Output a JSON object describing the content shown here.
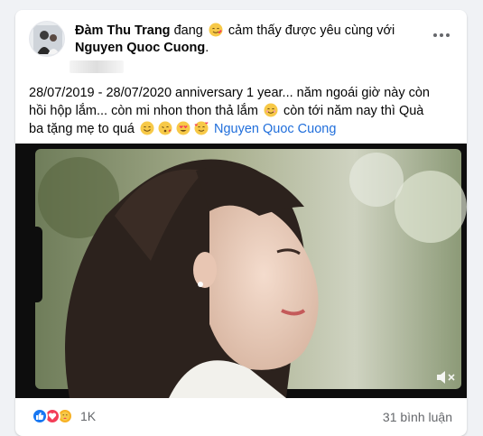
{
  "post": {
    "author": "Đàm Thu Trang",
    "feeling_prefix": "đang",
    "feeling_text": "cảm thấy được yêu cùng với",
    "tagged": "Nguyen Quoc Cuong",
    "tagged_period": ".",
    "body_line1": "28/07/2019 - 28/07/2020 anniversary 1 year... năm ngoái giờ này còn",
    "body_line2a": "hồi hộp lắm... còn mi nhon thon thả lắm",
    "body_line2b": "còn tới năm nay thì Quà",
    "body_line3a": "ba tặng mẹ to quá",
    "mention": "Nguyen Quoc Cuong"
  },
  "icons": {
    "feeling": "loved-emoji-icon",
    "more": "more-options-icon",
    "mute": "muted-speaker-icon",
    "like": "like-reaction-icon",
    "love": "love-reaction-icon",
    "care": "care-reaction-icon"
  },
  "stats": {
    "reaction_count": "1K",
    "comment_count": "31 bình luận"
  },
  "colors": {
    "link": "#216fdb",
    "like": "#1877f2",
    "love": "#f33e58",
    "care": "#f7b125"
  }
}
